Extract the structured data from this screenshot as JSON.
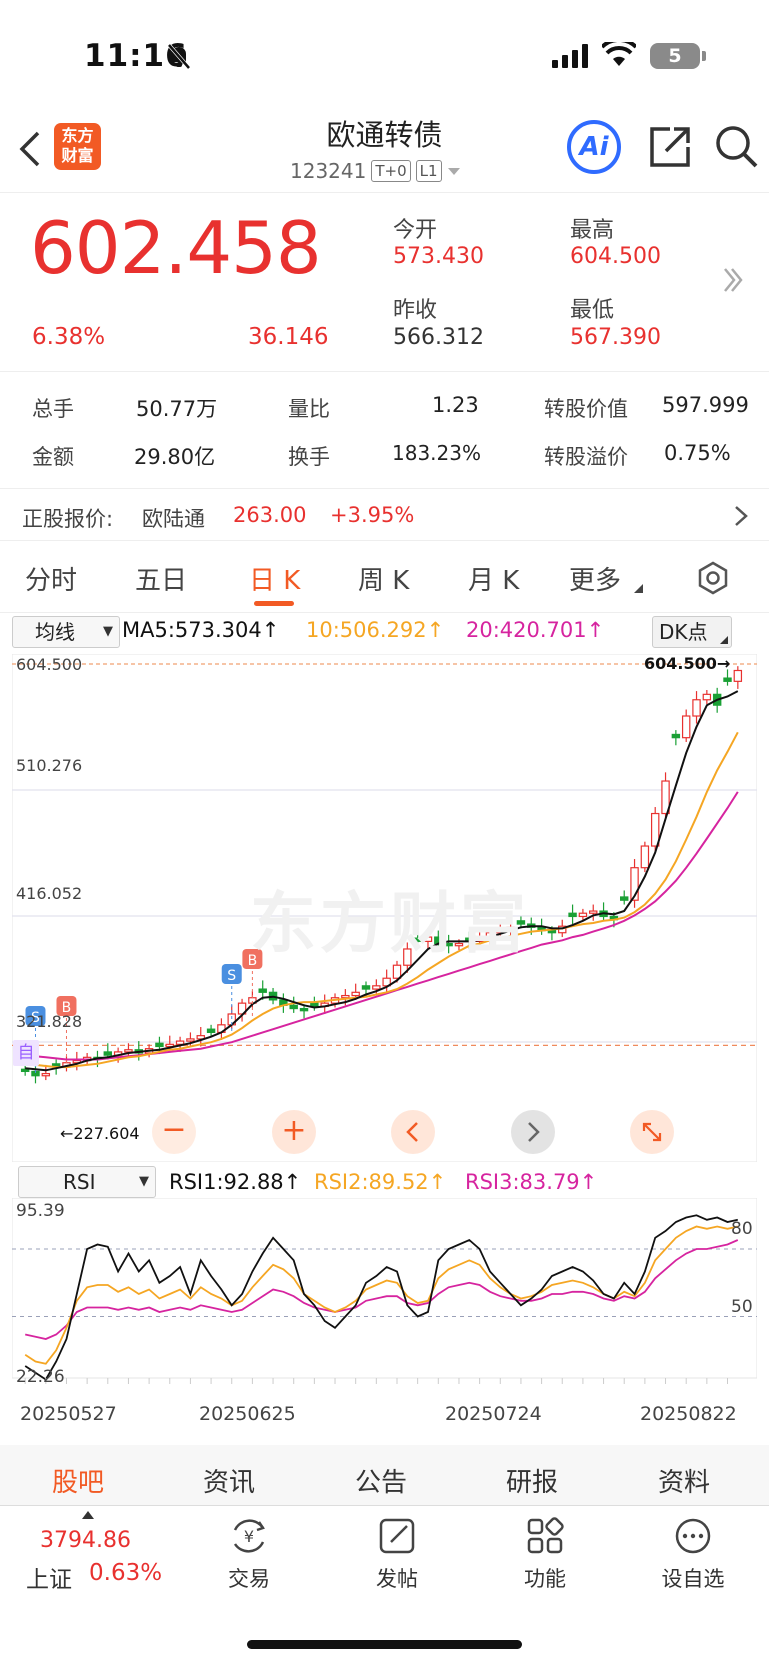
{
  "status": {
    "time": "11:16",
    "battery": "5"
  },
  "header": {
    "logo_line1": "东方",
    "logo_line2": "财富",
    "title": "欧通转债",
    "code": "123241",
    "tag1": "T+0",
    "tag2": "L1",
    "ai_label": "Ai"
  },
  "quote": {
    "price": "602.458",
    "change_pct": "6.38%",
    "change_amt": "36.146",
    "open_label": "今开",
    "open": "573.430",
    "high_label": "最高",
    "high": "604.500",
    "prev_label": "昨收",
    "prev": "566.312",
    "low_label": "最低",
    "low": "567.390"
  },
  "stats": {
    "vol_label": "总手",
    "vol": "50.77万",
    "ratio_label": "量比",
    "ratio": "1.23",
    "conv_label": "转股价值",
    "conv": "597.999",
    "amt_label": "金额",
    "amt": "29.80亿",
    "turn_label": "换手",
    "turn": "183.23%",
    "prem_label": "转股溢价",
    "prem": "0.75%"
  },
  "stock": {
    "label": "正股报价:",
    "name": "欧陆通",
    "price": "263.00",
    "change": "+3.95%"
  },
  "tabs": [
    "分时",
    "五日",
    "日 K",
    "周 K",
    "月 K",
    "更多"
  ],
  "chart": {
    "ma_select": "均线",
    "ma5": "MA5:573.304↑",
    "ma10": "10:506.292↑",
    "ma20": "20:420.701↑",
    "dk": "DK点",
    "rsi_select": "RSI",
    "rsi1": "RSI1:92.88↑",
    "rsi2": "RSI2:89.52↑",
    "rsi3": "RSI3:83.79↑",
    "watermark": "东方财富",
    "high_marker": "604.500→",
    "low_marker": "←227.604",
    "auto_tag": "自"
  },
  "chart_data": {
    "type": "candlestick",
    "price_axis_labels": [
      "604.500",
      "510.276",
      "416.052",
      "321.828"
    ],
    "rsi_axis_labels": [
      "95.39",
      "22.26"
    ],
    "rsi_levels": [
      "80",
      "50"
    ],
    "dates": [
      "20250527",
      "20250625",
      "20250724",
      "20250822"
    ],
    "closes": [
      232,
      228,
      230,
      236,
      240,
      242,
      245,
      243,
      247,
      250,
      252,
      249,
      253,
      255,
      257,
      260,
      262,
      265,
      268,
      275,
      285,
      295,
      300,
      305,
      298,
      293,
      290,
      288,
      292,
      295,
      300,
      302,
      305,
      308,
      311,
      318,
      330,
      345,
      352,
      356,
      350,
      348,
      350,
      352,
      356,
      360,
      362,
      365,
      368,
      365,
      362,
      360,
      366,
      375,
      378,
      380,
      375,
      372,
      390,
      420,
      440,
      470,
      500,
      540,
      560,
      575,
      580,
      570,
      592,
      602
    ],
    "ma5": [
      235,
      234,
      233,
      235,
      237,
      239,
      242,
      244,
      245,
      247,
      249,
      250,
      251,
      252,
      254,
      256,
      258,
      261,
      264,
      268,
      275,
      284,
      294,
      300,
      301,
      299,
      296,
      293,
      291,
      292,
      294,
      296,
      299,
      303,
      306,
      310,
      316,
      325,
      335,
      345,
      350,
      352,
      352,
      352,
      353,
      356,
      359,
      362,
      365,
      366,
      366,
      364,
      364,
      367,
      371,
      376,
      378,
      377,
      380,
      394,
      412,
      434,
      465,
      496,
      526,
      550,
      570,
      575,
      578,
      583
    ],
    "ma10": [
      240,
      238,
      237,
      236,
      236,
      237,
      238,
      239,
      241,
      243,
      245,
      246,
      248,
      250,
      252,
      253,
      255,
      257,
      259,
      262,
      266,
      272,
      279,
      285,
      290,
      293,
      295,
      296,
      296,
      297,
      298,
      299,
      300,
      301,
      303,
      305,
      308,
      313,
      319,
      326,
      332,
      338,
      343,
      348,
      350,
      353,
      355,
      357,
      359,
      361,
      362,
      363,
      364,
      366,
      368,
      369,
      371,
      372,
      374,
      379,
      386,
      396,
      409,
      426,
      446,
      467,
      490,
      510,
      527,
      545
    ],
    "ma20": [
      248,
      246,
      245,
      244,
      243,
      243,
      243,
      243,
      244,
      245,
      246,
      247,
      248,
      249,
      250,
      251,
      252,
      253,
      255,
      257,
      259,
      262,
      265,
      268,
      271,
      274,
      277,
      280,
      283,
      286,
      289,
      292,
      295,
      298,
      301,
      304,
      307,
      310,
      313,
      316,
      319,
      322,
      325,
      328,
      331,
      334,
      337,
      340,
      343,
      346,
      349,
      351,
      353,
      356,
      358,
      361,
      364,
      367,
      371,
      376,
      382,
      389,
      398,
      408,
      420,
      433,
      447,
      461,
      475,
      490
    ],
    "rsi1": [
      28,
      25,
      22,
      30,
      40,
      60,
      80,
      82,
      81,
      70,
      78,
      70,
      75,
      65,
      68,
      72,
      60,
      75,
      68,
      62,
      55,
      60,
      70,
      78,
      85,
      80,
      75,
      60,
      55,
      48,
      45,
      50,
      55,
      65,
      68,
      72,
      70,
      55,
      50,
      52,
      75,
      80,
      82,
      84,
      80,
      70,
      65,
      60,
      55,
      58,
      62,
      68,
      70,
      72,
      70,
      66,
      60,
      58,
      65,
      60,
      70,
      85,
      88,
      92,
      94,
      95,
      93,
      94,
      92,
      93
    ],
    "rsi2": [
      33,
      30,
      29,
      35,
      45,
      57,
      63,
      64,
      64,
      61,
      63,
      60,
      62,
      58,
      60,
      62,
      58,
      63,
      60,
      58,
      55,
      57,
      63,
      68,
      73,
      71,
      67,
      60,
      57,
      54,
      52,
      54,
      57,
      62,
      64,
      66,
      65,
      59,
      56,
      57,
      67,
      71,
      73,
      75,
      73,
      67,
      63,
      60,
      58,
      59,
      61,
      64,
      65,
      66,
      65,
      63,
      60,
      58,
      61,
      59,
      65,
      75,
      80,
      85,
      88,
      90,
      89,
      90,
      89,
      90
    ],
    "rsi3": [
      42,
      41,
      40,
      42,
      46,
      52,
      54,
      54,
      54,
      53,
      54,
      53,
      54,
      52,
      53,
      54,
      53,
      55,
      54,
      53,
      52,
      53,
      56,
      59,
      62,
      61,
      59,
      56,
      54,
      53,
      52,
      53,
      54,
      57,
      58,
      59,
      59,
      56,
      55,
      56,
      60,
      63,
      64,
      65,
      64,
      61,
      59,
      58,
      57,
      57,
      58,
      60,
      60,
      61,
      61,
      60,
      58,
      57,
      59,
      58,
      61,
      67,
      71,
      75,
      78,
      80,
      80,
      81,
      82,
      84
    ]
  },
  "bottom_tabs": [
    "股吧",
    "资讯",
    "公告",
    "研报",
    "资料"
  ],
  "index": {
    "value": "3794.86",
    "name": "上证",
    "change": "0.63%"
  },
  "nav": [
    "交易",
    "发帖",
    "功能",
    "设自选"
  ],
  "colors": {
    "up": "#e8312f",
    "down": "#1aa035",
    "accent": "#f25a24",
    "ma5": "#111111",
    "ma10": "#f5a623",
    "ma20": "#d6249f"
  }
}
